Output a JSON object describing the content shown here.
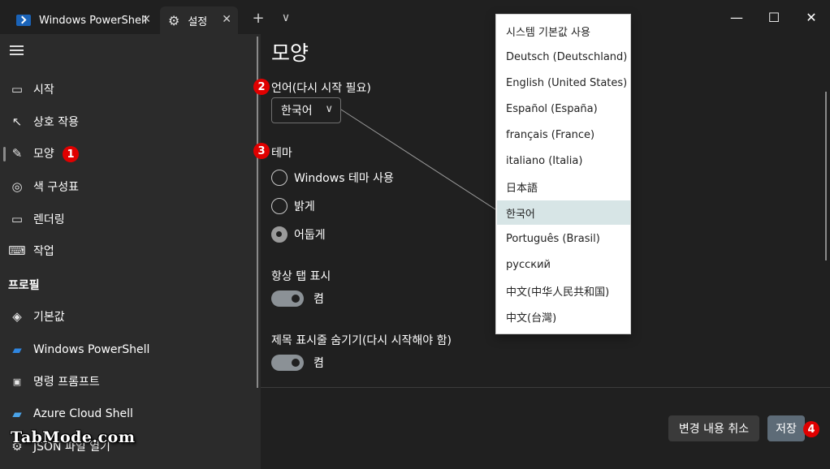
{
  "tabs": [
    {
      "label": "Windows PowerShell",
      "icon": "powershell-icon"
    },
    {
      "label": "설정",
      "icon": "gear-icon"
    }
  ],
  "titlebar": {
    "new_tab": "+",
    "dropdown": "⌵"
  },
  "window": {
    "minimize": "—",
    "maximize": "☐",
    "close": "✕"
  },
  "sidebar": {
    "items": [
      {
        "label": "시작",
        "icon": "startup-icon"
      },
      {
        "label": "상호 작용",
        "icon": "interaction-icon"
      },
      {
        "label": "모양",
        "icon": "brush-icon",
        "selected": true
      },
      {
        "label": "색 구성표",
        "icon": "palette-icon"
      },
      {
        "label": "렌더링",
        "icon": "monitor-icon"
      },
      {
        "label": "작업",
        "icon": "keyboard-icon"
      }
    ],
    "profiles_header": "프로필",
    "profiles": [
      {
        "label": "기본값",
        "icon": "layers-icon"
      },
      {
        "label": "Windows PowerShell",
        "icon": "powershell-icon"
      },
      {
        "label": "명령 프롬프트",
        "icon": "cmd-icon"
      },
      {
        "label": "Azure Cloud Shell",
        "icon": "azure-icon"
      },
      {
        "label": "JSON 파일 열기",
        "icon": "gear-icon"
      }
    ]
  },
  "main": {
    "title": "모양",
    "language_label": "언어(다시 시작 필요)",
    "language_value": "한국어",
    "theme_label": "테마",
    "theme_options": [
      {
        "label": "Windows 테마 사용",
        "checked": false
      },
      {
        "label": "밝게",
        "checked": false
      },
      {
        "label": "어둡게",
        "checked": true
      }
    ],
    "always_show_tabs_label": "항상 탭 표시",
    "always_show_tabs_state": "켬",
    "hide_titlebar_label": "제목 표시줄 숨기기(다시 시작해야 함)",
    "hide_titlebar_state": "켬"
  },
  "footer": {
    "discard_label": "변경 내용 취소",
    "save_label": "저장"
  },
  "dropdown": {
    "options": [
      "시스템 기본값 사용",
      "Deutsch (Deutschland)",
      "English (United States)",
      "Español (España)",
      "français (France)",
      "italiano (Italia)",
      "日本語",
      "한국어",
      "Português (Brasil)",
      "русский",
      "中文(中华人民共和国)",
      "中文(台灣)"
    ],
    "selected": "한국어"
  },
  "callouts": [
    "1",
    "2",
    "3",
    "4"
  ],
  "watermark": "TabMode.com",
  "colors": {
    "background": "#202020",
    "sidebar": "#2b2b2b",
    "callout": "#e00000",
    "dropdown_selected": "#d7e5e6",
    "save_button": "#5d6b77"
  }
}
